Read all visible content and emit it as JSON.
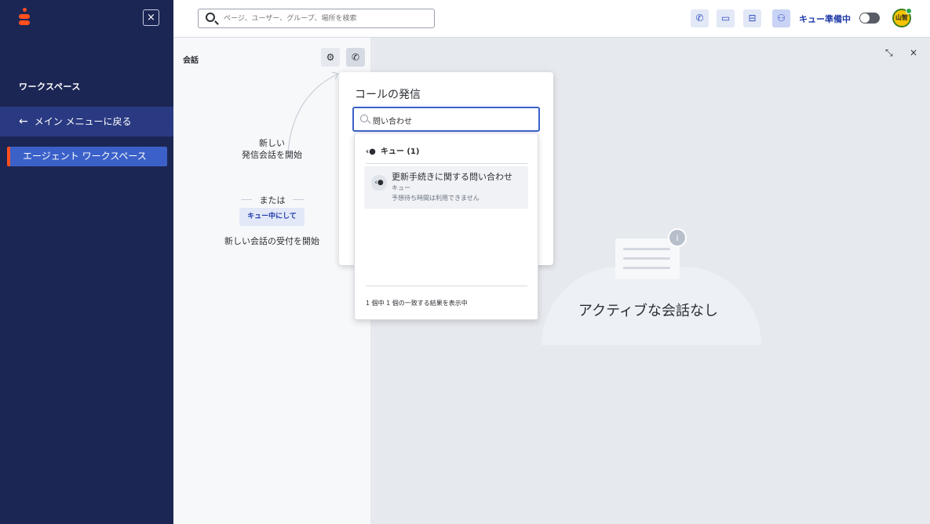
{
  "sidebar": {
    "close_label": "×",
    "title": "ワークスペース",
    "back_arrow": "←",
    "back_label": "メイン メニューに戻る",
    "items": [
      {
        "label": "エージェント ワークスペース"
      }
    ]
  },
  "topbar": {
    "search_placeholder": "ページ、ユーザー、グループ、場所を検索",
    "buttons": [
      {
        "icon": "phone-icon",
        "glyph": "✆"
      },
      {
        "icon": "chat-icon",
        "glyph": "▭"
      },
      {
        "icon": "inbox-icon",
        "glyph": "⊟"
      },
      {
        "icon": "agent-icon",
        "glyph": "⚇"
      }
    ],
    "queue_status": "キュー準備中",
    "avatar_text": "山智"
  },
  "conversation": {
    "title": "会話",
    "line1": "新しい",
    "line2": "発信会話を開始",
    "or": "または",
    "queue_button": "キュー中にして",
    "receive_text": "新しい会話の受付を開始"
  },
  "main": {
    "empty_text": "アクティブな会話なし",
    "info_glyph": "i",
    "minimize_glyph": "⤡",
    "close_glyph": "×"
  },
  "call_popover": {
    "title": "コールの発信",
    "search_value": "問い合わせ",
    "group_label": "キュー (1)",
    "result": {
      "name": "更新手続きに関する問い合わせ",
      "type": "キュー",
      "wait": "予想待ち時間は利用できません"
    },
    "footer": "1 個中 1 個の一致する結果を表示中"
  },
  "colors": {
    "sidebar_bg": "#1c2654",
    "accent": "#3b61c9",
    "brand": "#ff4f1f"
  }
}
